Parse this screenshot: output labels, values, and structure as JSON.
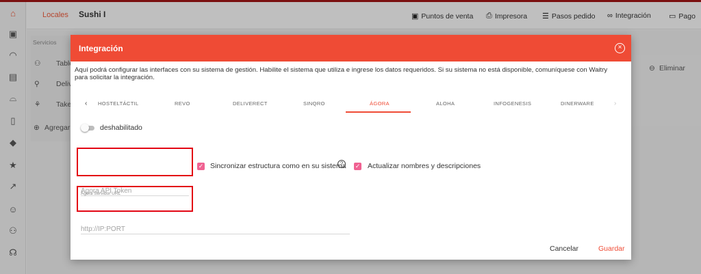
{
  "header": {
    "breadcrumb": "Locales",
    "venue_name": "Sushi I",
    "nav": [
      {
        "icon": "point-of-sale-icon",
        "glyph": "▣",
        "label": "Puntos de venta"
      },
      {
        "icon": "printer-icon",
        "glyph": "🖶",
        "label": "Impresora"
      },
      {
        "icon": "steps-icon",
        "glyph": "☰",
        "label": "Pasos pedido"
      },
      {
        "icon": "link-icon",
        "glyph": "⊖",
        "label": "Integración"
      },
      {
        "icon": "payment-icon",
        "glyph": "▭",
        "label": "Pago"
      }
    ]
  },
  "sidebar": {
    "icons": [
      "home-icon",
      "qr-icon",
      "tray-icon",
      "menu-card-icon",
      "food-icon",
      "book-icon",
      "tag-icon",
      "star-icon",
      "trend-icon",
      "smile-icon",
      "users-icon",
      "support-icon"
    ]
  },
  "background": {
    "section_label": "Servicios",
    "services": [
      "Table",
      "Deliv",
      "Take"
    ],
    "add_label": "Agregar",
    "delete_label": "Eliminar"
  },
  "modal": {
    "title": "Integración",
    "description": "Aquí podrá configurar las interfaces con su sistema de gestión. Habilite el sistema que utiliza e ingrese los datos requeridos. Si su sistema no está disponible, comuníquese con Waitry para solicitar la integración.",
    "tabs": [
      "HOSTELTÁCTIL",
      "REVO",
      "DELIVERECT",
      "SINQRO",
      "ÁGORA",
      "ALOHA",
      "INFOGENESIS",
      "DINERWARE"
    ],
    "active_tab": "ÁGORA",
    "toggle_label": "deshabilitado",
    "api_token_placeholder": "Agora API Token",
    "server_url_label": "Agora Servidor URL",
    "server_url_placeholder": "http://IP:PORT",
    "sync_structure_label": "Sincronizar estructura como en su sistema",
    "update_names_label": "Actualizar nombres y descripciones",
    "cancel_label": "Cancelar",
    "save_label": "Guardar"
  },
  "colors": {
    "accent": "#ef4b35",
    "checkbox": "#f06292",
    "highlight_box": "#e30613"
  }
}
